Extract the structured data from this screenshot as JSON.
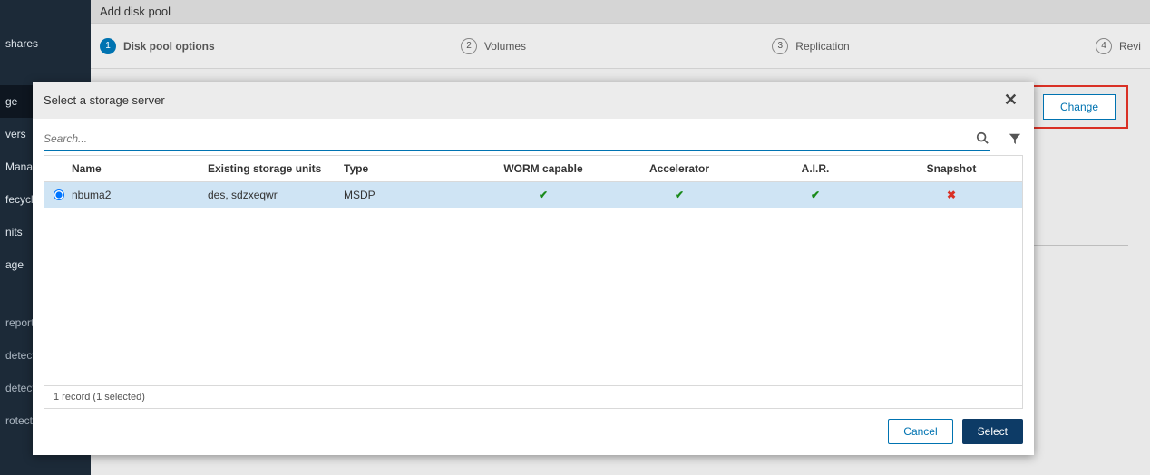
{
  "sidebar": {
    "items": [
      {
        "label": "shares"
      },
      {
        "label": ""
      },
      {
        "label": "ge",
        "active": true
      },
      {
        "label": "vers"
      },
      {
        "label": "Manage"
      },
      {
        "label": "fecycle p"
      },
      {
        "label": "nits"
      },
      {
        "label": "age"
      }
    ],
    "items2": [
      {
        "label": "reporting"
      },
      {
        "label": "detection"
      },
      {
        "label": "detection"
      },
      {
        "label": "rotection"
      }
    ]
  },
  "page": {
    "title": "Add disk pool",
    "change_label": "Change"
  },
  "stepper": {
    "s1": {
      "num": "1",
      "label": "Disk pool options"
    },
    "s2": {
      "num": "2",
      "label": "Volumes"
    },
    "s3": {
      "num": "3",
      "label": "Replication"
    },
    "s4": {
      "num": "4",
      "label": "Revi"
    }
  },
  "modal": {
    "title": "Select a storage server",
    "search_placeholder": "Search...",
    "headers": {
      "name": "Name",
      "units": "Existing storage units",
      "type": "Type",
      "worm": "WORM capable",
      "accel": "Accelerator",
      "air": "A.I.R.",
      "snap": "Snapshot"
    },
    "rows": [
      {
        "selected": true,
        "name": "nbuma2",
        "units": "des, sdzxeqwr",
        "type": "MSDP",
        "worm": "check",
        "accel": "check",
        "air": "check",
        "snap": "x"
      }
    ],
    "footer": "1 record (1 selected)",
    "cancel_label": "Cancel",
    "select_label": "Select"
  }
}
